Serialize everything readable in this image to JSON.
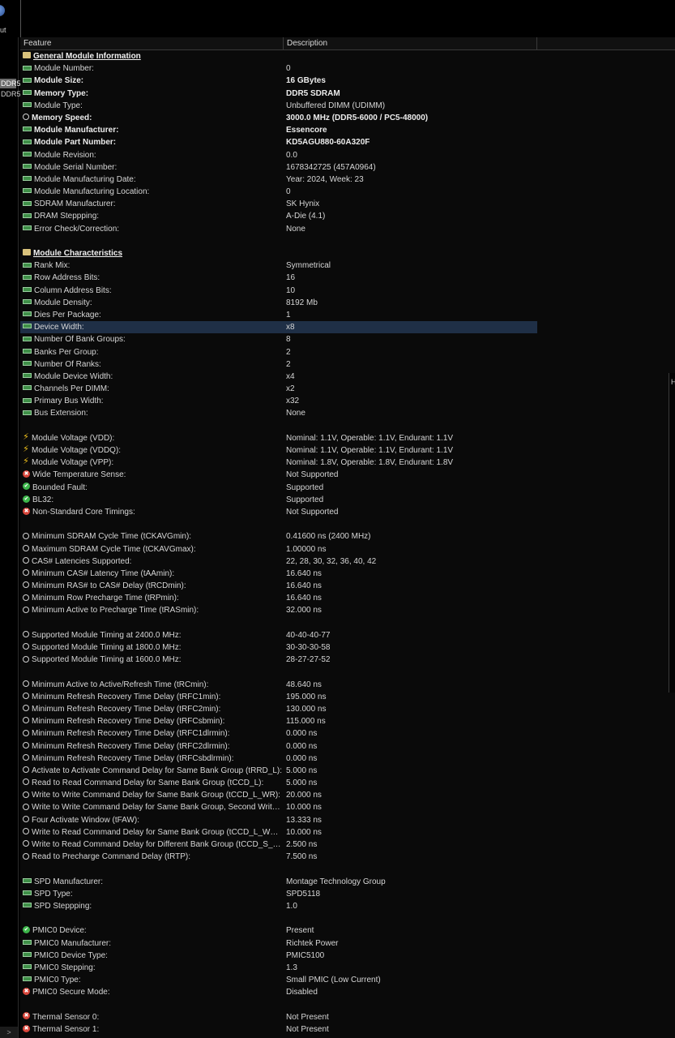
{
  "app": {
    "label": "ut"
  },
  "left_panel": {
    "items": [
      "DDR5",
      "DDR5"
    ],
    "scroll_glyph": ">"
  },
  "right_strip_label": "H",
  "columns": {
    "feature": "Feature",
    "description": "Description"
  },
  "rows": [
    {
      "icon": "folder",
      "feature": "General Module Information",
      "value": "",
      "style": "section"
    },
    {
      "icon": "mod",
      "feature": "Module Number:",
      "value": "0"
    },
    {
      "icon": "mod",
      "feature": "Module Size:",
      "value": "16 GBytes",
      "style": "bold"
    },
    {
      "icon": "mod",
      "feature": "Memory Type:",
      "value": "DDR5 SDRAM",
      "style": "bold"
    },
    {
      "icon": "mod",
      "feature": "Module Type:",
      "value": "Unbuffered DIMM (UDIMM)"
    },
    {
      "icon": "clock",
      "feature": "Memory Speed:",
      "value": "3000.0 MHz (DDR5-6000 / PC5-48000)",
      "style": "bold"
    },
    {
      "icon": "mod",
      "feature": "Module Manufacturer:",
      "value": "Essencore",
      "style": "bold"
    },
    {
      "icon": "mod",
      "feature": "Module Part Number:",
      "value": "KD5AGU880-60A320F",
      "style": "bold"
    },
    {
      "icon": "mod",
      "feature": "Module Revision:",
      "value": "0.0"
    },
    {
      "icon": "mod",
      "feature": "Module Serial Number:",
      "value": "1678342725 (457A0964)"
    },
    {
      "icon": "mod",
      "feature": "Module Manufacturing Date:",
      "value": "Year: 2024, Week: 23"
    },
    {
      "icon": "mod",
      "feature": "Module Manufacturing Location:",
      "value": "0"
    },
    {
      "icon": "mod",
      "feature": "SDRAM Manufacturer:",
      "value": "SK Hynix"
    },
    {
      "icon": "mod",
      "feature": "DRAM Steppping:",
      "value": "A-Die (4.1)"
    },
    {
      "icon": "mod",
      "feature": "Error Check/Correction:",
      "value": "None"
    },
    {
      "icon": "",
      "feature": "",
      "value": ""
    },
    {
      "icon": "folder",
      "feature": "Module Characteristics",
      "value": "",
      "style": "section"
    },
    {
      "icon": "mod",
      "feature": "Rank Mix:",
      "value": "Symmetrical"
    },
    {
      "icon": "mod",
      "feature": "Row Address Bits:",
      "value": "16"
    },
    {
      "icon": "mod",
      "feature": "Column Address Bits:",
      "value": "10"
    },
    {
      "icon": "mod",
      "feature": "Module Density:",
      "value": "8192 Mb"
    },
    {
      "icon": "mod",
      "feature": "Dies Per Package:",
      "value": "1"
    },
    {
      "icon": "mod",
      "feature": "Device Width:",
      "value": "x8",
      "style": "sel"
    },
    {
      "icon": "mod",
      "feature": "Number Of Bank Groups:",
      "value": "8"
    },
    {
      "icon": "mod",
      "feature": "Banks Per Group:",
      "value": "2"
    },
    {
      "icon": "mod",
      "feature": "Number Of Ranks:",
      "value": "2"
    },
    {
      "icon": "mod",
      "feature": "Module Device Width:",
      "value": "x4"
    },
    {
      "icon": "mod",
      "feature": "Channels Per DIMM:",
      "value": "x2"
    },
    {
      "icon": "mod",
      "feature": "Primary Bus Width:",
      "value": "x32"
    },
    {
      "icon": "mod",
      "feature": "Bus Extension:",
      "value": "None"
    },
    {
      "icon": "",
      "feature": "",
      "value": ""
    },
    {
      "icon": "bolt",
      "feature": "Module Voltage (VDD):",
      "value": "Nominal: 1.1V, Operable: 1.1V, Endurant: 1.1V"
    },
    {
      "icon": "bolt",
      "feature": "Module Voltage (VDDQ):",
      "value": "Nominal: 1.1V, Operable: 1.1V, Endurant: 1.1V"
    },
    {
      "icon": "bolt",
      "feature": "Module Voltage (VPP):",
      "value": "Nominal: 1.8V, Operable: 1.8V, Endurant: 1.8V"
    },
    {
      "icon": "err",
      "feature": "Wide Temperature Sense:",
      "value": "Not Supported"
    },
    {
      "icon": "ok",
      "feature": "Bounded Fault:",
      "value": "Supported"
    },
    {
      "icon": "ok",
      "feature": "BL32:",
      "value": "Supported"
    },
    {
      "icon": "err",
      "feature": "Non-Standard Core Timings:",
      "value": "Not Supported"
    },
    {
      "icon": "",
      "feature": "",
      "value": ""
    },
    {
      "icon": "clock",
      "feature": "Minimum SDRAM Cycle Time (tCKAVGmin):",
      "value": "0.41600 ns (2400 MHz)"
    },
    {
      "icon": "clock",
      "feature": "Maximum SDRAM Cycle Time (tCKAVGmax):",
      "value": "1.00000 ns"
    },
    {
      "icon": "clock",
      "feature": "CAS# Latencies Supported:",
      "value": "22, 28, 30, 32, 36, 40, 42"
    },
    {
      "icon": "clock",
      "feature": "Minimum CAS# Latency Time (tAAmin):",
      "value": "16.640 ns"
    },
    {
      "icon": "clock",
      "feature": "Minimum RAS# to CAS# Delay (tRCDmin):",
      "value": "16.640 ns"
    },
    {
      "icon": "clock",
      "feature": "Minimum Row Precharge Time (tRPmin):",
      "value": "16.640 ns"
    },
    {
      "icon": "clock",
      "feature": "Minimum Active to Precharge Time (tRASmin):",
      "value": "32.000 ns"
    },
    {
      "icon": "",
      "feature": "",
      "value": ""
    },
    {
      "icon": "clock",
      "feature": "Supported Module Timing at 2400.0 MHz:",
      "value": "40-40-40-77"
    },
    {
      "icon": "clock",
      "feature": "Supported Module Timing at 1800.0 MHz:",
      "value": "30-30-30-58"
    },
    {
      "icon": "clock",
      "feature": "Supported Module Timing at 1600.0 MHz:",
      "value": "28-27-27-52"
    },
    {
      "icon": "",
      "feature": "",
      "value": ""
    },
    {
      "icon": "clock",
      "feature": "Minimum Active to Active/Refresh Time (tRCmin):",
      "value": "48.640 ns"
    },
    {
      "icon": "clock",
      "feature": "Minimum Refresh Recovery Time Delay (tRFC1min):",
      "value": "195.000 ns"
    },
    {
      "icon": "clock",
      "feature": "Minimum Refresh Recovery Time Delay (tRFC2min):",
      "value": "130.000 ns"
    },
    {
      "icon": "clock",
      "feature": "Minimum Refresh Recovery Time Delay (tRFCsbmin):",
      "value": "115.000 ns"
    },
    {
      "icon": "clock",
      "feature": "Minimum Refresh Recovery Time Delay (tRFC1dlrmin):",
      "value": "0.000 ns"
    },
    {
      "icon": "clock",
      "feature": "Minimum Refresh Recovery Time Delay (tRFC2dlrmin):",
      "value": "0.000 ns"
    },
    {
      "icon": "clock",
      "feature": "Minimum Refresh Recovery Time Delay (tRFCsbdlrmin):",
      "value": "0.000 ns"
    },
    {
      "icon": "clock",
      "feature": "Activate to Activate Command Delay for Same Bank Group (tRRD_L):",
      "value": "5.000 ns"
    },
    {
      "icon": "clock",
      "feature": "Read to Read Command Delay for Same Bank Group (tCCD_L):",
      "value": "5.000 ns"
    },
    {
      "icon": "clock",
      "feature": "Write to Write Command Delay for Same Bank Group (tCCD_L_WR):",
      "value": "20.000 ns"
    },
    {
      "icon": "clock",
      "feature": "Write to Write Command Delay for Same Bank Group, Second Write no...",
      "value": "10.000 ns"
    },
    {
      "icon": "clock",
      "feature": "Four Activate Window (tFAW):",
      "value": "13.333 ns"
    },
    {
      "icon": "clock",
      "feature": "Write to Read Command Delay for Same Bank Group (tCCD_L_WTR):",
      "value": "10.000 ns"
    },
    {
      "icon": "clock",
      "feature": "Write to Read Command Delay for Different Bank Group (tCCD_S_WTR):",
      "value": "2.500 ns"
    },
    {
      "icon": "clock",
      "feature": "Read to Precharge Command Delay (tRTP):",
      "value": "7.500 ns"
    },
    {
      "icon": "",
      "feature": "",
      "value": ""
    },
    {
      "icon": "mod",
      "feature": "SPD Manufacturer:",
      "value": "Montage Technology Group"
    },
    {
      "icon": "mod",
      "feature": "SPD Type:",
      "value": "SPD5118"
    },
    {
      "icon": "mod",
      "feature": "SPD Steppping:",
      "value": "1.0"
    },
    {
      "icon": "",
      "feature": "",
      "value": ""
    },
    {
      "icon": "ok",
      "feature": "PMIC0 Device:",
      "value": "Present"
    },
    {
      "icon": "mod",
      "feature": "PMIC0 Manufacturer:",
      "value": "Richtek Power"
    },
    {
      "icon": "mod",
      "feature": "PMIC0 Device Type:",
      "value": "PMIC5100"
    },
    {
      "icon": "mod",
      "feature": "PMIC0 Stepping:",
      "value": "1.3"
    },
    {
      "icon": "mod",
      "feature": "PMIC0 Type:",
      "value": "Small PMIC (Low Current)"
    },
    {
      "icon": "err",
      "feature": "PMIC0 Secure Mode:",
      "value": "Disabled"
    },
    {
      "icon": "",
      "feature": "",
      "value": ""
    },
    {
      "icon": "err",
      "feature": "Thermal Sensor 0:",
      "value": "Not Present"
    },
    {
      "icon": "err",
      "feature": "Thermal Sensor 1:",
      "value": "Not Present"
    }
  ]
}
